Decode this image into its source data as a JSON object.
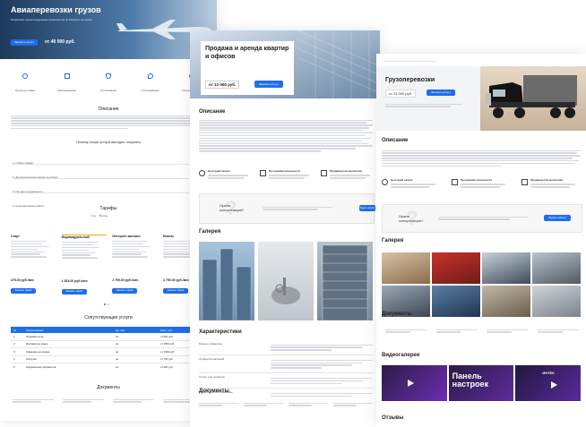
{
  "left": {
    "hero_title": "Авиаперевозки грузов",
    "hero_subtitle": "Перевозка грузов воздушным транспортом по России и за рубеж",
    "price_prefix": "от",
    "price": "от 40 000 руб.",
    "hero_button": "Заказать услугу",
    "features": [
      "Сроки доставки",
      "Авиаперевозка",
      "Страхование",
      "Отслеживание",
      "Сопровождение"
    ],
    "description_title": "Описание",
    "why_title": "Почему наши услуги выгодно покупать",
    "why_items": [
      "1. Гибкие скидки",
      "2. Дополнительная скидка за объём",
      "3. Полная прозрачность",
      "4. Корпоративная работа"
    ],
    "tariffs_title": "Тарифы",
    "tariff_tabs": [
      "Год",
      "Месяц"
    ],
    "tariffs": [
      {
        "name": "Старт",
        "price": "475.00 руб./мес",
        "button": "Заказать тариф"
      },
      {
        "name": "Индивидуальный",
        "price": "1 524.00 руб./мес",
        "button": "Заказать тариф"
      },
      {
        "name": "Интернет-магазин",
        "price": "2 790.00 руб./мес",
        "button": "Заказать тариф"
      },
      {
        "name": "Бизнес",
        "price": "4 790.00 руб./мес",
        "button": "Заказать тариф"
      }
    ],
    "services_title": "Сопутствующие услуги",
    "services_header": [
      "№",
      "Наименование",
      "Ед. изм",
      "Цена, руб."
    ],
    "services_rows": [
      {
        "num": "1",
        "name": "Упаковка груза",
        "unit": "шт",
        "price": "от 500 руб."
      },
      {
        "num": "2",
        "name": "Доставка до двери",
        "unit": "шт",
        "price": "от 1500 руб."
      },
      {
        "name": "Хранение на складе",
        "num": "3",
        "unit": "шт",
        "price": "от 1000 руб."
      },
      {
        "num": "4",
        "name": "Погрузка",
        "unit": "шт",
        "price": "от 700 руб."
      },
      {
        "num": "5",
        "name": "Оформление документов",
        "unit": "шт",
        "price": "от 900 руб."
      }
    ],
    "documents_title": "Документы"
  },
  "center": {
    "title": "Продажа и аренда квартир и офисов",
    "price": "от 12 000 руб.",
    "button": "Заказать услугу",
    "description_title": "Описание",
    "features": [
      "Быстрый запуск",
      "Программа лояльности",
      "Продвинутая аналитика"
    ],
    "consult_text": "Нужна консультация?",
    "consult_button": "Задать вопрос",
    "gallery_title": "Галерея",
    "characteristics_title": "Характеристики",
    "characteristics": [
      "Ремонт в квартире",
      "Профессиональный",
      "Услуги для клиентов",
      "Гарантия на обслуживание"
    ],
    "documents_title": "Документы"
  },
  "right": {
    "title": "Грузоперевозки",
    "price": "от 23 000 руб.",
    "button": "Заказать услугу",
    "description_title": "Описание",
    "features": [
      "Быстрый запуск",
      "Программа лояльности",
      "Продвинутая аналитика"
    ],
    "consult_text": "Нужна консультация?",
    "consult_button": "Задать вопрос",
    "gallery_title": "Галерея",
    "documents_title": "Документы",
    "video_title": "Видеогалерея",
    "video_captions": [
      "",
      "Панель настроек",
      "ИНТЕК"
    ],
    "reviews_title": "Отзывы"
  },
  "colors": {
    "accent": "#1e6ee8",
    "hero_dark": "#1d3a5c",
    "text": "#222222"
  }
}
